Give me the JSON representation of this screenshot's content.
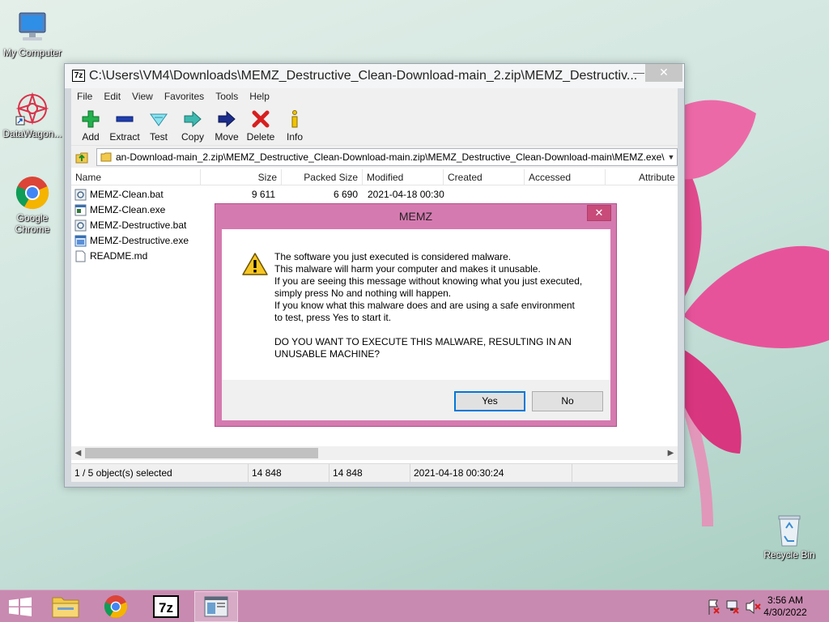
{
  "desktop": {
    "icons": [
      {
        "label": "My Computer",
        "icon": "computer-icon"
      },
      {
        "label": "DataWagon...",
        "icon": "datawagon-icon"
      },
      {
        "label": "Google Chrome",
        "icon": "chrome-icon"
      },
      {
        "label": "Recycle Bin",
        "icon": "recycle-bin-icon"
      }
    ]
  },
  "window": {
    "title": "C:\\Users\\VM4\\Downloads\\MEMZ_Destructive_Clean-Download-main_2.zip\\MEMZ_Destructiv...",
    "app_icon_text": "7z",
    "controls": {
      "minimize": "—",
      "close": "✕"
    },
    "menu": [
      "File",
      "Edit",
      "View",
      "Favorites",
      "Tools",
      "Help"
    ],
    "toolbar": [
      {
        "label": "Add",
        "icon": "add-icon"
      },
      {
        "label": "Extract",
        "icon": "extract-icon"
      },
      {
        "label": "Test",
        "icon": "test-icon"
      },
      {
        "label": "Copy",
        "icon": "copy-icon"
      },
      {
        "label": "Move",
        "icon": "move-icon"
      },
      {
        "label": "Delete",
        "icon": "delete-icon"
      },
      {
        "label": "Info",
        "icon": "info-icon"
      }
    ],
    "address": "an-Download-main_2.zip\\MEMZ_Destructive_Clean-Download-main.zip\\MEMZ_Destructive_Clean-Download-main\\MEMZ.exe\\",
    "columns": [
      "Name",
      "Size",
      "Packed Size",
      "Modified",
      "Created",
      "Accessed",
      "Attribute"
    ],
    "files": [
      {
        "name": "MEMZ-Clean.bat",
        "size": "9 611",
        "packed": "6 690",
        "modified": "2021-04-18 00:30",
        "icon": "bat-file-icon"
      },
      {
        "name": "MEMZ-Clean.exe",
        "size": "",
        "packed": "",
        "modified": "",
        "icon": "exe-file-icon"
      },
      {
        "name": "MEMZ-Destructive.bat",
        "size": "",
        "packed": "",
        "modified": "",
        "icon": "bat-file-icon"
      },
      {
        "name": "MEMZ-Destructive.exe",
        "size": "",
        "packed": "",
        "modified": "",
        "icon": "exe-file-icon"
      },
      {
        "name": "README.md",
        "size": "",
        "packed": "",
        "modified": "",
        "icon": "text-file-icon"
      }
    ],
    "status": {
      "selection": "1 / 5 object(s) selected",
      "size": "14 848",
      "packed": "14 848",
      "modified": "2021-04-18 00:30:24"
    }
  },
  "dialog": {
    "title": "MEMZ",
    "close": "✕",
    "icon": "warning-icon",
    "lines_1": [
      "The software you just executed is considered malware.",
      "This malware will harm your computer and makes it unusable.",
      "If you are seeing this message without knowing what you just executed,",
      "simply press No and nothing will happen.",
      "If you know what this malware does and are using a safe environment",
      "to test, press Yes to start it."
    ],
    "lines_2": [
      "DO YOU WANT TO EXECUTE THIS MALWARE, RESULTING IN AN",
      "UNUSABLE MACHINE?"
    ],
    "yes": "Yes",
    "no": "No"
  },
  "taskbar": {
    "items": [
      "start-icon",
      "file-explorer-icon",
      "chrome-icon",
      "7zip-icon",
      "window-icon"
    ],
    "clock_time": "3:56 AM",
    "clock_date": "4/30/2022"
  },
  "colors": {
    "dialog_frame": "#d57ab0",
    "taskbar": "#c88ab0",
    "accent": "#0078d7"
  }
}
